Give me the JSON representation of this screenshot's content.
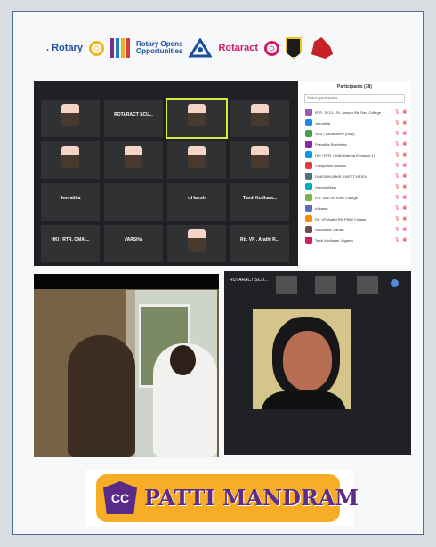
{
  "logos": {
    "rotary": ". Rotary",
    "rotary_opens": "Rotary Opens",
    "opportunities": "Opportunities",
    "rotaract": "Rotaract"
  },
  "meeting": {
    "participants_header": "Participants (38)",
    "search_placeholder": "Search participants",
    "tiles": [
      {
        "label": "",
        "caption": "",
        "avatar": true
      },
      {
        "label": "ROTARACT SCU...",
        "caption": "",
        "avatar": false
      },
      {
        "label": "",
        "caption": "",
        "avatar": true,
        "selected": true
      },
      {
        "label": "",
        "caption": "",
        "avatar": true
      },
      {
        "label": "",
        "caption": "",
        "avatar": true
      },
      {
        "label": "",
        "caption": "",
        "avatar": true
      },
      {
        "label": "",
        "caption": "",
        "avatar": true
      },
      {
        "label": "",
        "caption": "",
        "avatar": true
      },
      {
        "label": "Jeevaitha",
        "caption": "",
        "avatar": false
      },
      {
        "label": "",
        "caption": "",
        "avatar": false
      },
      {
        "label": "rd karsh",
        "caption": "",
        "avatar": false
      },
      {
        "label": "Tamil Kodhala...",
        "caption": "",
        "avatar": false
      },
      {
        "label": "HKI | RTR. OMAI...",
        "caption": "",
        "avatar": false
      },
      {
        "label": "VARSHA",
        "caption": "",
        "avatar": false
      },
      {
        "label": "",
        "caption": "",
        "avatar": true
      },
      {
        "label": "Rtr. VP . Arathi R...",
        "caption": "",
        "avatar": false
      },
      {
        "label": "",
        "caption": "",
        "avatar": false
      },
      {
        "label": "",
        "caption": "",
        "avatar": true
      },
      {
        "label": "",
        "caption": "",
        "avatar": true
      },
      {
        "label": "",
        "caption": "",
        "avatar": false
      }
    ],
    "participants": [
      "RTR. SKCL | St. Joseph Rtr. Ravi College",
      "Jeevaitha",
      "SCU | Kandhavely (Host)",
      "Pravalika Ravindran",
      "HKI | RTR. OMAI Kalinga (Rotaract 1)",
      "Pushpamol Rozerio",
      "DINESHKUMAR SWEETYADEV",
      "Yasmin Akbar",
      "RTr. SKU St. Rose College",
      "rd karsh",
      "Rtr. VP. Arathi Rtr. PMW Collage",
      "Nandhana Jeevan",
      "Tamil Kodhalan Jegatan"
    ],
    "participant_colors": [
      "#9b59b6",
      "#1e88e5",
      "#43a047",
      "#8e24aa",
      "#039be5",
      "#e53935",
      "#546e7a",
      "#00acc1",
      "#7cb342",
      "#5c6bc0",
      "#fb8c00",
      "#6d4c41",
      "#d81b60"
    ]
  },
  "call": {
    "name": "ROTARACT SCU..."
  },
  "banner": {
    "badge": "CC",
    "title": "PATTI MANDRAM"
  },
  "colors": {
    "frame_border": "#4d6c9a",
    "rotary_blue": "#1b4f9d",
    "rotaract_pink": "#d21b63",
    "banner_orange": "#f7ad25",
    "banner_purple": "#5d2b88"
  }
}
